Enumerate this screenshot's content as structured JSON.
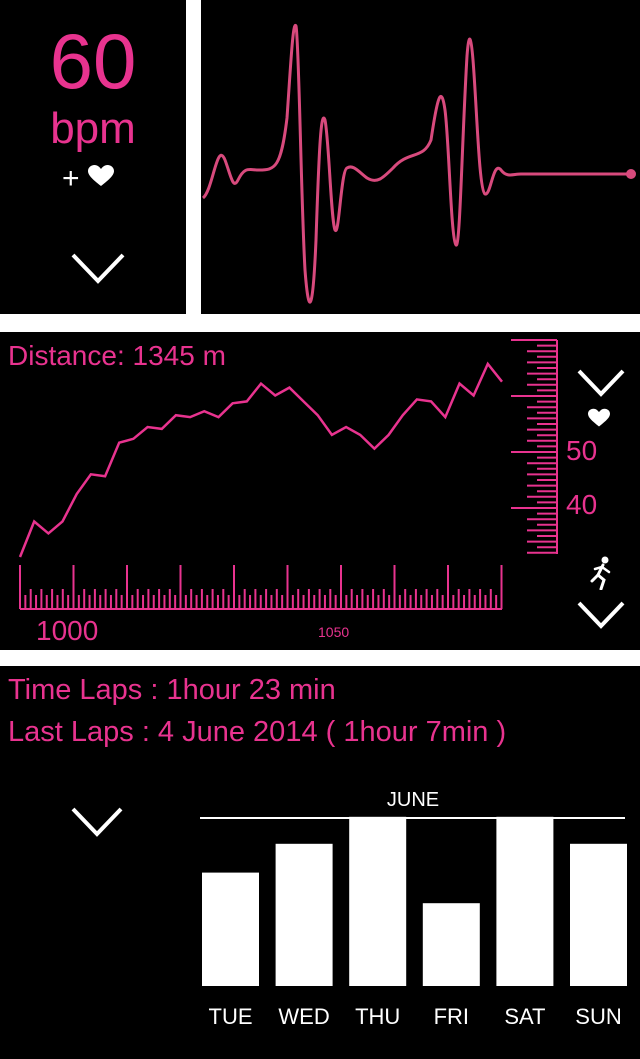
{
  "heart_rate": {
    "value": "60",
    "unit": "bpm",
    "add_symbol": "+"
  },
  "distance": {
    "label": "Distance: 1345 m",
    "x_tick_labels": [
      "1000",
      "1050"
    ],
    "right_scale_labels": [
      "50",
      "40"
    ],
    "trend": [
      0,
      0.18,
      0.12,
      0.18,
      0.32,
      0.42,
      0.41,
      0.58,
      0.6,
      0.66,
      0.65,
      0.72,
      0.71,
      0.74,
      0.71,
      0.78,
      0.79,
      0.88,
      0.82,
      0.86,
      0.79,
      0.72,
      0.62,
      0.66,
      0.62,
      0.55,
      0.62,
      0.72,
      0.8,
      0.79,
      0.71,
      0.88,
      0.82,
      0.98,
      0.89
    ]
  },
  "laps": {
    "time_laps": "Time Laps : 1hour 23 min",
    "last_laps": "Last Laps : 4 June 2014 ( 1hour 7min )"
  },
  "colors": {
    "accent": "#e8338f",
    "ecg": "#d84a7d",
    "bar": "#ffffff",
    "panel": "#000000"
  },
  "icons": [
    "heart-icon",
    "runner-icon",
    "chevron-down-icon"
  ],
  "chart_data": {
    "type": "bar",
    "title": "JUNE",
    "categories": [
      "TUE",
      "WED",
      "THU",
      "FRI",
      "SAT",
      "SUN"
    ],
    "values": [
      0.63,
      0.79,
      0.94,
      0.46,
      0.94,
      0.79
    ],
    "ylim": [
      0,
      1
    ],
    "grid": false,
    "legend": "none"
  }
}
